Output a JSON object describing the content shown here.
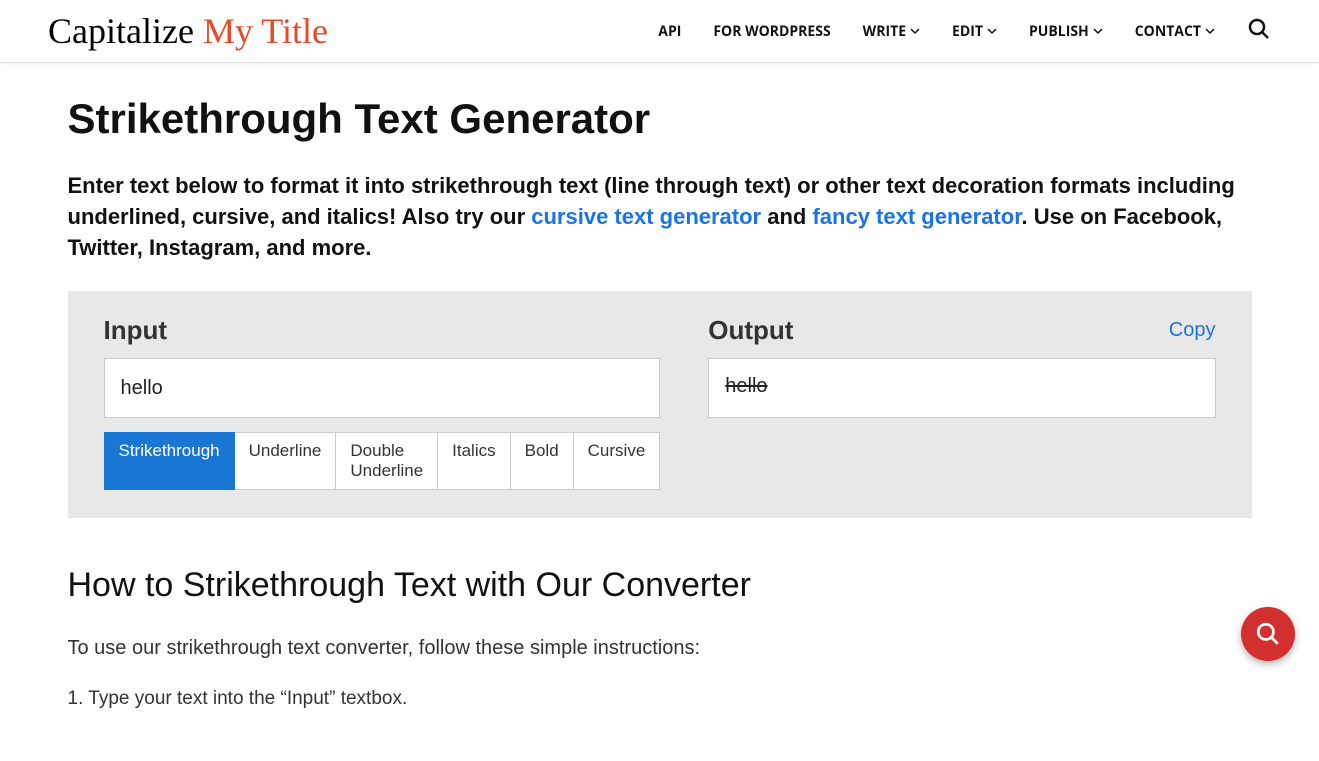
{
  "logo": {
    "part1": "Capitalize ",
    "part2": "My Title"
  },
  "nav": {
    "items": [
      {
        "label": "API",
        "hasDropdown": false
      },
      {
        "label": "FOR WORDPRESS",
        "hasDropdown": false
      },
      {
        "label": "WRITE",
        "hasDropdown": true
      },
      {
        "label": "EDIT",
        "hasDropdown": true
      },
      {
        "label": "PUBLISH",
        "hasDropdown": true
      },
      {
        "label": "CONTACT",
        "hasDropdown": true
      }
    ]
  },
  "page": {
    "title": "Strikethrough Text Generator",
    "intro_text_1": "Enter text below to format it into strikethrough text (line through text) or other text decoration formats including underlined, cursive, and italics! Also try our ",
    "link_1": "cursive text generator",
    "intro_text_2": " and ",
    "link_2": "fancy text generator",
    "intro_text_3": ". Use on Facebook, Twitter, Instagram, and more."
  },
  "tool": {
    "input_label": "Input",
    "output_label": "Output",
    "copy_label": "Copy",
    "input_value": "hello",
    "output_value": "hello",
    "tabs": [
      {
        "label": "Strikethrough",
        "active": true
      },
      {
        "label": "Underline",
        "active": false
      },
      {
        "label": "Double Underline",
        "active": false
      },
      {
        "label": "Italics",
        "active": false
      },
      {
        "label": "Bold",
        "active": false
      },
      {
        "label": "Cursive",
        "active": false
      }
    ]
  },
  "howto": {
    "title": "How to Strikethrough Text with Our Converter",
    "intro": "To use our strikethrough text converter, follow these simple instructions:",
    "step1": "1. Type your text into the “Input” textbox."
  }
}
